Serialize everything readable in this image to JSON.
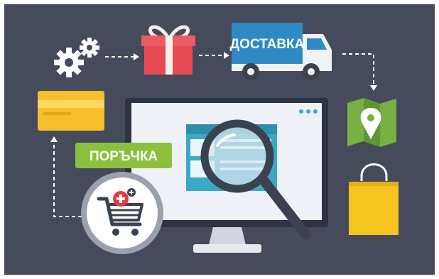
{
  "labels": {
    "delivery": "ДОСТАВКА",
    "order": "ПОРЪЧКА"
  },
  "colors": {
    "background": "#464b5c",
    "gift_red": "#e64b55",
    "gift_ribbon": "#f4f0ec",
    "truck_blue": "#2f8ac4",
    "truck_white": "#f1f2f4",
    "card_yellow": "#f6c02a",
    "order_green": "#8bc03f",
    "map_green": "#78b043",
    "bag_yellow": "#f7c520",
    "monitor_frame": "#2c3342",
    "monitor_screen": "#eef2f6",
    "page_teal": "#3aa9c6",
    "magnifier": "#3a4250",
    "cart_ring": "#9aa0ac",
    "plus_red": "#e63946"
  },
  "icons": [
    "gears-icon",
    "gift-icon",
    "delivery-truck-icon",
    "map-pin-icon",
    "shopping-bag-icon",
    "credit-card-icon",
    "order-tag",
    "shopping-cart-icon",
    "monitor-icon",
    "magnifier-icon"
  ]
}
